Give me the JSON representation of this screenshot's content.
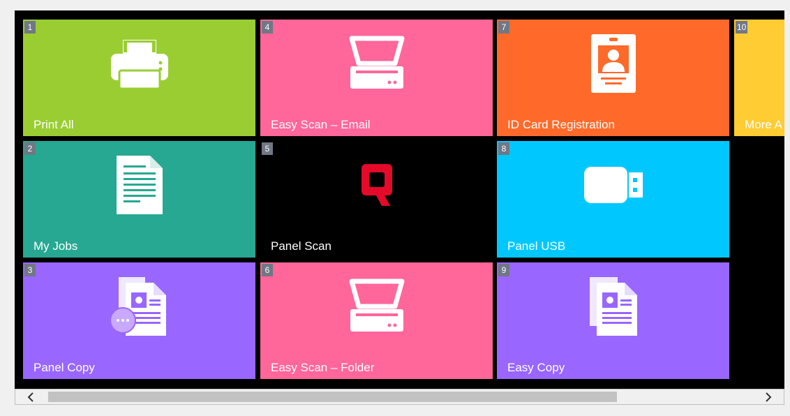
{
  "tiles": [
    {
      "num": "1",
      "label": "Print All",
      "color": "#9acd32",
      "icon": "printer-icon"
    },
    {
      "num": "2",
      "label": "My Jobs",
      "color": "#26a892",
      "icon": "document-icon"
    },
    {
      "num": "3",
      "label": "Panel Copy",
      "color": "#9966ff",
      "icon": "copy-options-icon"
    },
    {
      "num": "4",
      "label": "Easy Scan – Email",
      "color": "#ff6699",
      "icon": "scanner-icon"
    },
    {
      "num": "5",
      "label": "Panel Scan",
      "color": "#000000",
      "icon": "q-logo-icon"
    },
    {
      "num": "6",
      "label": "Easy Scan – Folder",
      "color": "#ff6699",
      "icon": "scanner-icon"
    },
    {
      "num": "7",
      "label": "ID Card Registration",
      "color": "#ff6a2a",
      "icon": "id-card-icon"
    },
    {
      "num": "8",
      "label": "Panel USB",
      "color": "#00c8ff",
      "icon": "usb-icon"
    },
    {
      "num": "9",
      "label": "Easy Copy",
      "color": "#9966ff",
      "icon": "copy-icon"
    },
    {
      "num": "10",
      "label": "More A",
      "color": "#ffcc33",
      "icon": ""
    }
  ],
  "scrollbar": {
    "left_arrow": "‹",
    "right_arrow": "›",
    "thumb_fraction": 0.78
  },
  "colors": {
    "background": "#000000",
    "badge": "#707785",
    "logo_red": "#e30a2a"
  }
}
